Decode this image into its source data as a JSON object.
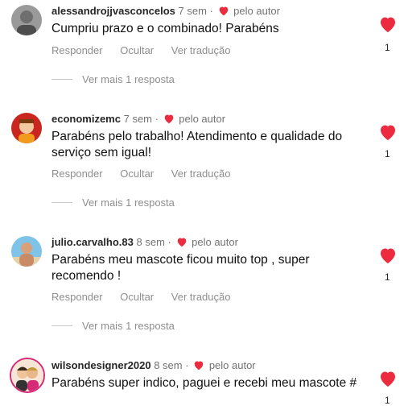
{
  "labels": {
    "reply": "Responder",
    "hide": "Ocultar",
    "translate": "Ver tradução",
    "author_like": "pelo autor",
    "separator": "·"
  },
  "colors": {
    "heart": "#ed2b40",
    "muted": "#8e8e8e"
  },
  "comments": [
    {
      "username": "alessandrojjvasconcelos",
      "time": "7 sem",
      "text": "Cumpriu prazo e o combinado! Parabéns",
      "likes": "1",
      "more": "Ver mais 1 resposta",
      "avatar_icon": "grey-portrait-avatar"
    },
    {
      "username": "economizemc",
      "time": "7 sem",
      "text": "Parabéns pelo trabalho! Atendimento e qualidade do serviço sem igual!",
      "likes": "1",
      "more": "Ver mais 1 resposta",
      "avatar_icon": "red-mascot-avatar"
    },
    {
      "username": "julio.carvalho.83",
      "time": "8 sem",
      "text": "Parabéns meu mascote ficou muito top , super recomendo !",
      "likes": "1",
      "more": "Ver mais 1 resposta",
      "avatar_icon": "beach-portrait-avatar"
    },
    {
      "username": "wilsondesigner2020",
      "time": "8 sem",
      "text": "Parabéns super indico, paguei e recebi meu mascote #",
      "likes": "1",
      "avatar_icon": "couple-cartoon-avatar"
    }
  ]
}
